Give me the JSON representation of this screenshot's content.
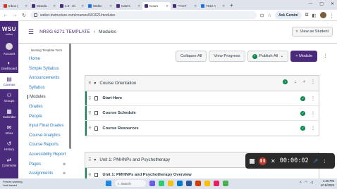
{
  "browser": {
    "tabs": [
      {
        "label": "Inbox (",
        "color": "#d93025",
        "active": false
      },
      {
        "label": "Standa",
        "color": "#4a2a7a",
        "active": false
      },
      {
        "label": "4.9 - Gi",
        "color": "#4a2a7a",
        "active": false
      },
      {
        "label": "Webin",
        "color": "#1a73e8",
        "active": false
      },
      {
        "label": "Cate's",
        "color": "#4a2a7a",
        "active": false
      },
      {
        "label": "Cours",
        "color": "#4a2a7a",
        "active": true
      },
      {
        "label": "**ACT",
        "color": "#4a2a7a",
        "active": false
      },
      {
        "label": "7912 A",
        "color": "#1a73e8",
        "active": false
      }
    ],
    "new_tab": "+",
    "url": "weber.instructure.com/courses/601621/modules",
    "ask_label": "Ask Gemini"
  },
  "global_nav": {
    "logo_main": "WSU",
    "logo_sub": "online",
    "items": [
      {
        "label": "Account",
        "icon": "account-icon",
        "glyph": "●",
        "active": false
      },
      {
        "label": "Dashboard",
        "icon": "dashboard-icon",
        "glyph": "◐",
        "active": false
      },
      {
        "label": "Courses",
        "icon": "courses-icon",
        "glyph": "▤",
        "active": true
      },
      {
        "label": "Groups",
        "icon": "groups-icon",
        "glyph": "⚇",
        "active": false
      },
      {
        "label": "Calendar",
        "icon": "calendar-icon",
        "glyph": "▦",
        "active": false
      },
      {
        "label": "Inbox",
        "icon": "inbox-icon",
        "glyph": "✉",
        "active": false
      },
      {
        "label": "History",
        "icon": "history-icon",
        "glyph": "↺",
        "active": false
      },
      {
        "label": "Commons",
        "icon": "commons-icon",
        "glyph": "⇄",
        "active": false
      }
    ]
  },
  "header": {
    "course": "NRSG 6271 TEMPLATE",
    "page": "Modules",
    "view_as_student": "View as Student"
  },
  "course_nav": {
    "term": "Nursing Template Term",
    "items": [
      {
        "label": "Home",
        "active": false,
        "hidden": false
      },
      {
        "label": "Simple Syllabus",
        "active": false,
        "hidden": false
      },
      {
        "label": "Announcements",
        "active": false,
        "hidden": false
      },
      {
        "label": "Syllabus",
        "active": false,
        "hidden": false
      },
      {
        "label": "Modules",
        "active": true,
        "hidden": false
      },
      {
        "label": "Grades",
        "active": false,
        "hidden": false
      },
      {
        "label": "People",
        "active": false,
        "hidden": false
      },
      {
        "label": "Input Final Grades",
        "active": false,
        "hidden": false
      },
      {
        "label": "Course Analytics",
        "active": false,
        "hidden": false
      },
      {
        "label": "Course Reports",
        "active": false,
        "hidden": false
      },
      {
        "label": "Accessibility Report",
        "active": false,
        "hidden": false
      },
      {
        "label": "Pages",
        "active": false,
        "hidden": true
      },
      {
        "label": "Assignments",
        "active": false,
        "hidden": true
      }
    ]
  },
  "toolbar": {
    "collapse_all": "Collapse All",
    "view_progress": "View Progress",
    "publish_all": "Publish All",
    "add_module": "+ Module"
  },
  "modules": [
    {
      "title": "Course Orientation",
      "items": [
        {
          "title": "Start Here"
        },
        {
          "title": "Course Schedule"
        },
        {
          "title": "Course Resources"
        }
      ]
    },
    {
      "title": "Unit 1: PMHNPs and Psychotherapy",
      "items": [
        {
          "title": "Unit 1: PMHNPs and Psychotherapy Overview"
        }
      ]
    }
  ],
  "recorder": {
    "time": "00:00:02"
  },
  "taskbar": {
    "weather_title": "Freeze warning",
    "weather_sub": "Just issued",
    "search_placeholder": "Search",
    "time": "4:45 PM",
    "date": "4/15/2026"
  }
}
